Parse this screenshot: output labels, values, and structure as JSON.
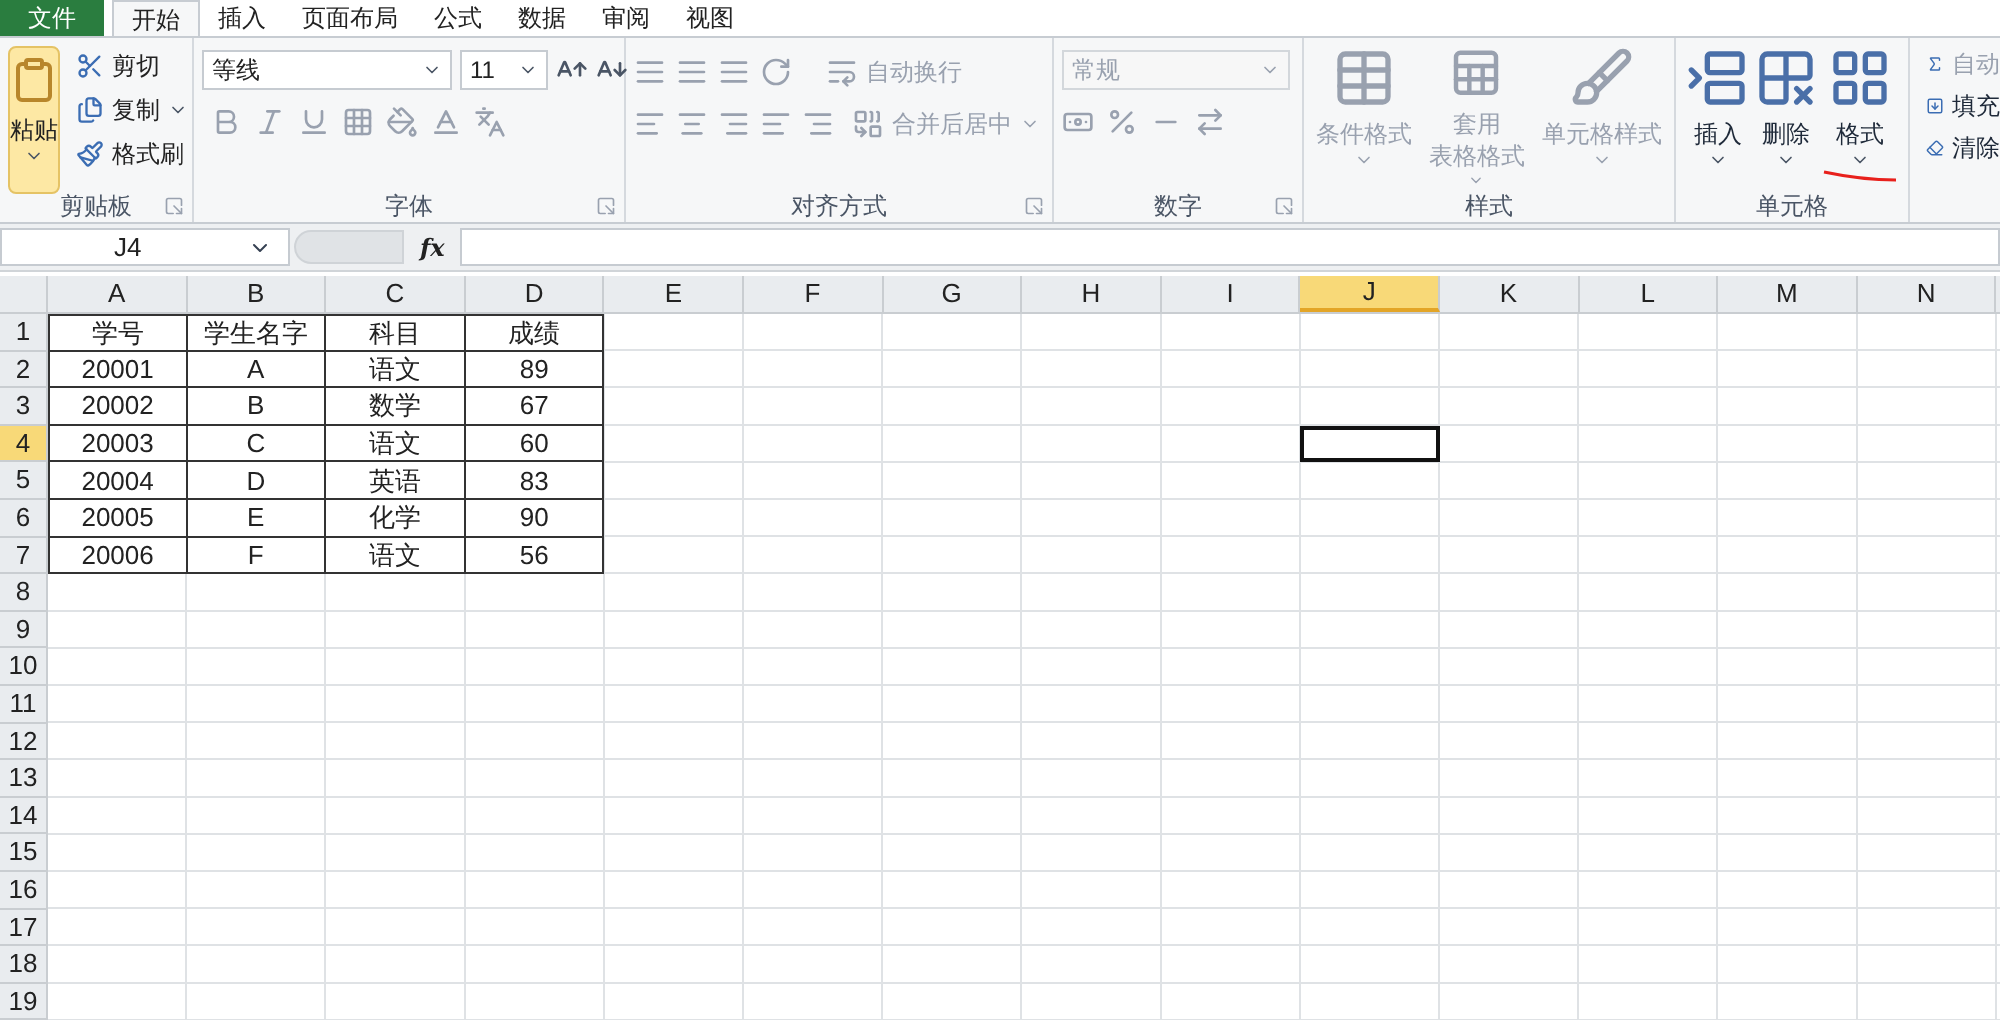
{
  "menu_tabs": [
    {
      "label": "文件",
      "kind": "file",
      "selected": false
    },
    {
      "label": "开始",
      "kind": "tab",
      "selected": true
    },
    {
      "label": "插入",
      "kind": "tab",
      "selected": false
    },
    {
      "label": "页面布局",
      "kind": "tab",
      "selected": false
    },
    {
      "label": "公式",
      "kind": "tab",
      "selected": false
    },
    {
      "label": "数据",
      "kind": "tab",
      "selected": false
    },
    {
      "label": "审阅",
      "kind": "tab",
      "selected": false
    },
    {
      "label": "视图",
      "kind": "tab",
      "selected": false
    }
  ],
  "ribbon": [
    {
      "kind": "clipboard",
      "label": "剪贴板",
      "launcher": true,
      "paste": {
        "label": "粘贴",
        "highlighted": true
      },
      "small_buttons": [
        {
          "label": "剪切",
          "dropdown": false
        },
        {
          "label": "复制",
          "dropdown": true
        },
        {
          "label": "格式刷",
          "dropdown": false
        }
      ]
    },
    {
      "kind": "font",
      "label": "字体",
      "launcher": true,
      "font_name": "等线",
      "font_size": "11"
    },
    {
      "kind": "alignment",
      "label": "对齐方式",
      "launcher": true,
      "wrap_text": {
        "label": "自动换行",
        "disabled": true
      },
      "merge": {
        "label": "合并后居中",
        "disabled": true
      }
    },
    {
      "kind": "number",
      "label": "数字",
      "launcher": true,
      "format": {
        "value": "常规",
        "disabled": true
      }
    },
    {
      "kind": "styles",
      "label": "样式",
      "launcher": false,
      "buttons": [
        {
          "lines": [
            "条件格式"
          ],
          "disabled": true
        },
        {
          "lines": [
            "套用",
            "表格格式"
          ],
          "disabled": true
        },
        {
          "lines": [
            "单元格样式"
          ],
          "disabled": true
        }
      ]
    },
    {
      "kind": "cells",
      "label": "单元格",
      "launcher": false,
      "buttons": [
        {
          "label": "插入",
          "underlined": false
        },
        {
          "label": "删除",
          "underlined": false
        },
        {
          "label": "格式",
          "underlined": true
        }
      ]
    },
    {
      "kind": "editing",
      "items": [
        {
          "label": "自动",
          "disabled": true
        },
        {
          "label": "填充",
          "disabled": false
        },
        {
          "label": "清除",
          "disabled": false
        }
      ]
    }
  ],
  "formula_bar": {
    "name_box": "J4",
    "function_label": "fx"
  },
  "columns": [
    {
      "label": "A",
      "selected": false
    },
    {
      "label": "B",
      "selected": false
    },
    {
      "label": "C",
      "selected": false
    },
    {
      "label": "D",
      "selected": false
    },
    {
      "label": "E",
      "selected": false
    },
    {
      "label": "F",
      "selected": false
    },
    {
      "label": "G",
      "selected": false
    },
    {
      "label": "H",
      "selected": false
    },
    {
      "label": "I",
      "selected": false
    },
    {
      "label": "J",
      "selected": true
    },
    {
      "label": "K",
      "selected": false
    },
    {
      "label": "L",
      "selected": false
    },
    {
      "label": "M",
      "selected": false
    },
    {
      "label": "N",
      "selected": false
    }
  ],
  "rows": [
    {
      "label": "1",
      "selected": false
    },
    {
      "label": "2",
      "selected": false
    },
    {
      "label": "3",
      "selected": false
    },
    {
      "label": "4",
      "selected": true
    },
    {
      "label": "5",
      "selected": false
    },
    {
      "label": "6",
      "selected": false
    },
    {
      "label": "7",
      "selected": false
    },
    {
      "label": "8",
      "selected": false
    },
    {
      "label": "9",
      "selected": false
    },
    {
      "label": "10",
      "selected": false
    },
    {
      "label": "11",
      "selected": false
    },
    {
      "label": "12",
      "selected": false
    },
    {
      "label": "13",
      "selected": false
    },
    {
      "label": "14",
      "selected": false
    },
    {
      "label": "15",
      "selected": false
    },
    {
      "label": "16",
      "selected": false
    },
    {
      "label": "17",
      "selected": false
    },
    {
      "label": "18",
      "selected": false
    },
    {
      "label": "19",
      "selected": false
    }
  ],
  "table": [
    [
      "学号",
      "学生名字",
      "科目",
      "成绩"
    ],
    [
      "20001",
      "A",
      "语文",
      "89"
    ],
    [
      "20002",
      "B",
      "数学",
      "67"
    ],
    [
      "20003",
      "C",
      "语文",
      "60"
    ],
    [
      "20004",
      "D",
      "英语",
      "83"
    ],
    [
      "20005",
      "E",
      "化学",
      "90"
    ],
    [
      "20006",
      "F",
      "语文",
      "56"
    ]
  ]
}
